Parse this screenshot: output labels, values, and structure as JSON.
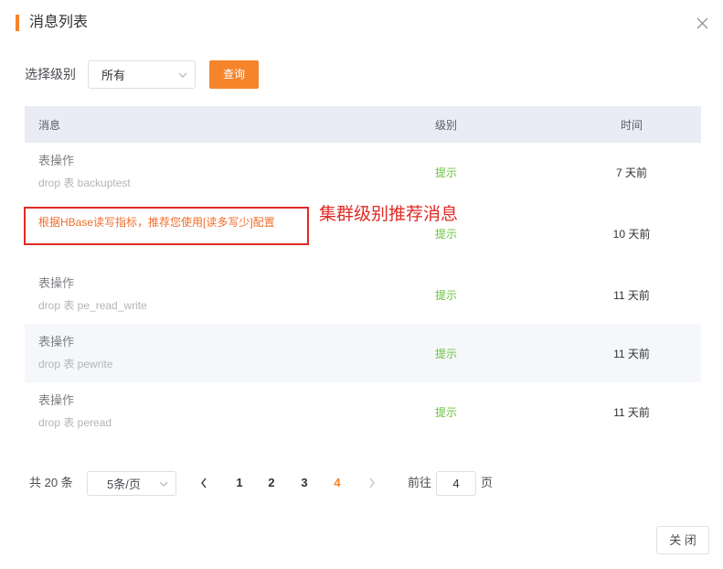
{
  "dialog": {
    "title": "消息列表"
  },
  "filter": {
    "label": "选择级别",
    "level_value": "所有",
    "query_button": "查询"
  },
  "table": {
    "columns": [
      "消息",
      "级别",
      "时间"
    ],
    "rows": [
      {
        "title": "表操作",
        "detail": "drop 表 backuptest",
        "level": "提示",
        "time": "7 天前"
      },
      {
        "title": "根据HBase读写指标，推荐您使用[读多写少]配置",
        "level": "提示",
        "time": "10 天前"
      },
      {
        "title": "表操作",
        "detail": "drop 表 pe_read_write",
        "level": "提示",
        "time": "11 天前"
      },
      {
        "title": "表操作",
        "detail": "drop 表 pewrite",
        "level": "提示",
        "time": "11 天前"
      },
      {
        "title": "表操作",
        "detail": "drop 表 peread",
        "level": "提示",
        "time": "11 天前"
      }
    ]
  },
  "annotation": {
    "text": "集群级别推荐消息"
  },
  "pagination": {
    "total": "共 20 条",
    "page_size": "5条/页",
    "pages": [
      "1",
      "2",
      "3",
      "4"
    ],
    "current_page": "4",
    "jump_label": "前往",
    "jump_value": "4",
    "jump_suffix": "页"
  },
  "footer": {
    "close_button": "关 闭"
  },
  "icons": {
    "close": "close-icon",
    "level_select_arrow": "chevron-down-icon",
    "page_size_arrow": "chevron-down-icon",
    "prev_page": "chevron-left-icon",
    "next_page": "chevron-right-icon"
  },
  "colors": {
    "accent": "#f5842b",
    "level_info": "#67c23a",
    "recommend_text": "#f06d2a",
    "annotation": "#e02b26",
    "header_bg": "#e9ecf4"
  }
}
